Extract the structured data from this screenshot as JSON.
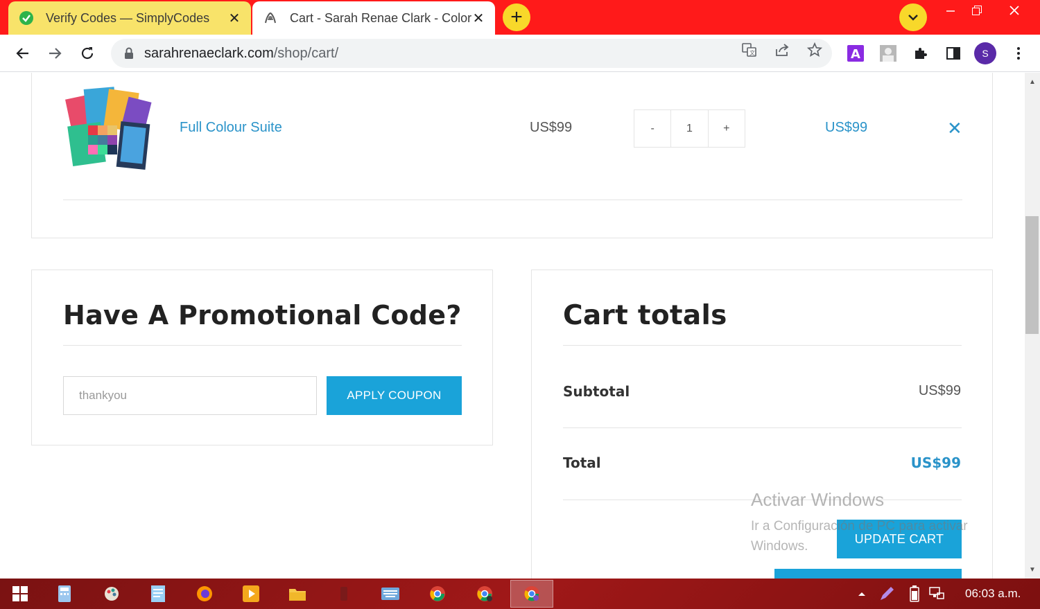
{
  "browser": {
    "tabs": [
      {
        "label": "Verify Codes — SimplyCodes",
        "close": "✕"
      },
      {
        "label": "Cart - Sarah Renae Clark - Coloring",
        "close": "✕"
      }
    ],
    "new_tab": "+",
    "url_host": "sarahrenaeclark.com",
    "url_path": "/shop/cart/",
    "profile_initial": "S",
    "accent_color": "#ff1a1a"
  },
  "cart": {
    "item": {
      "name": "Full Colour Suite",
      "price": "US$99",
      "qty_minus": "-",
      "qty_value": "1",
      "qty_plus": "+",
      "subtotal": "US$99",
      "remove": "✕"
    }
  },
  "promo": {
    "heading": "Have A Promotional Code?",
    "coupon_value": "thankyou",
    "apply_label": "APPLY COUPON"
  },
  "totals": {
    "heading": "Cart totals",
    "subtotal_label": "Subtotal",
    "subtotal_value": "US$99",
    "total_label": "Total",
    "total_value": "US$99",
    "update_label": "UPDATE CART"
  },
  "watermark": {
    "title": "Activar Windows",
    "subtitle": "Ir a Configuración de PC para activar Windows."
  },
  "taskbar": {
    "clock": "06:03 a.m."
  },
  "colors": {
    "link_blue": "#2a93c9",
    "button_blue": "#1aa3d9"
  }
}
